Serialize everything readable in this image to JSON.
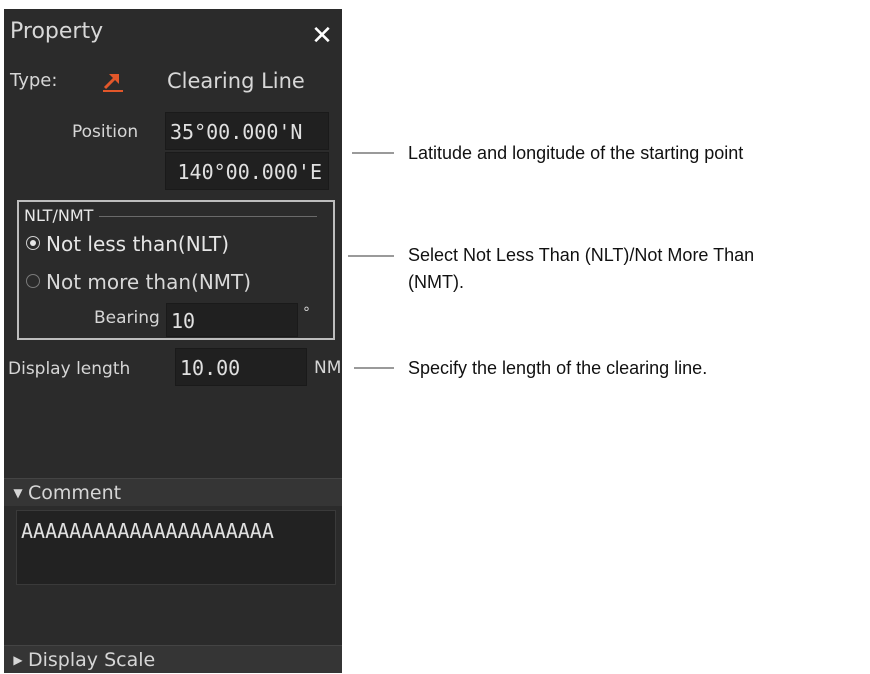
{
  "panel": {
    "title": "Property",
    "close_symbol": "✕",
    "type_label": "Type:",
    "type_icon": "clearing-line-icon",
    "type_value": "Clearing Line",
    "position_label": "Position",
    "latitude": "35°00.000'N",
    "longitude": "140°00.000'E",
    "nlt_nmt": {
      "group_title": "NLT/NMT",
      "options": [
        "Not less than(NLT)",
        "Not more than(NMT)"
      ],
      "selected": "Not less than(NLT)",
      "bearing_label": "Bearing",
      "bearing_value": "10",
      "bearing_unit": "°"
    },
    "display_length_label": "Display length",
    "display_length_value": "10.00",
    "display_length_unit": "NM",
    "comment_header": "Comment",
    "comment_text": "AAAAAAAAAAAAAAAAAAAAA",
    "display_scale_header": "Display Scale"
  },
  "callouts": {
    "position": "Latitude and longitude of the starting point",
    "nlt_nmt_line1": "Select Not Less Than (NLT)/Not More Than",
    "nlt_nmt_line2": "(NMT).",
    "display_length": "Specify the length of the clearing line."
  },
  "colors": {
    "panel_bg": "#2b2b2b",
    "field_bg": "#202020",
    "icon_orange": "#e2572a",
    "group_border": "#bdbdbd"
  }
}
